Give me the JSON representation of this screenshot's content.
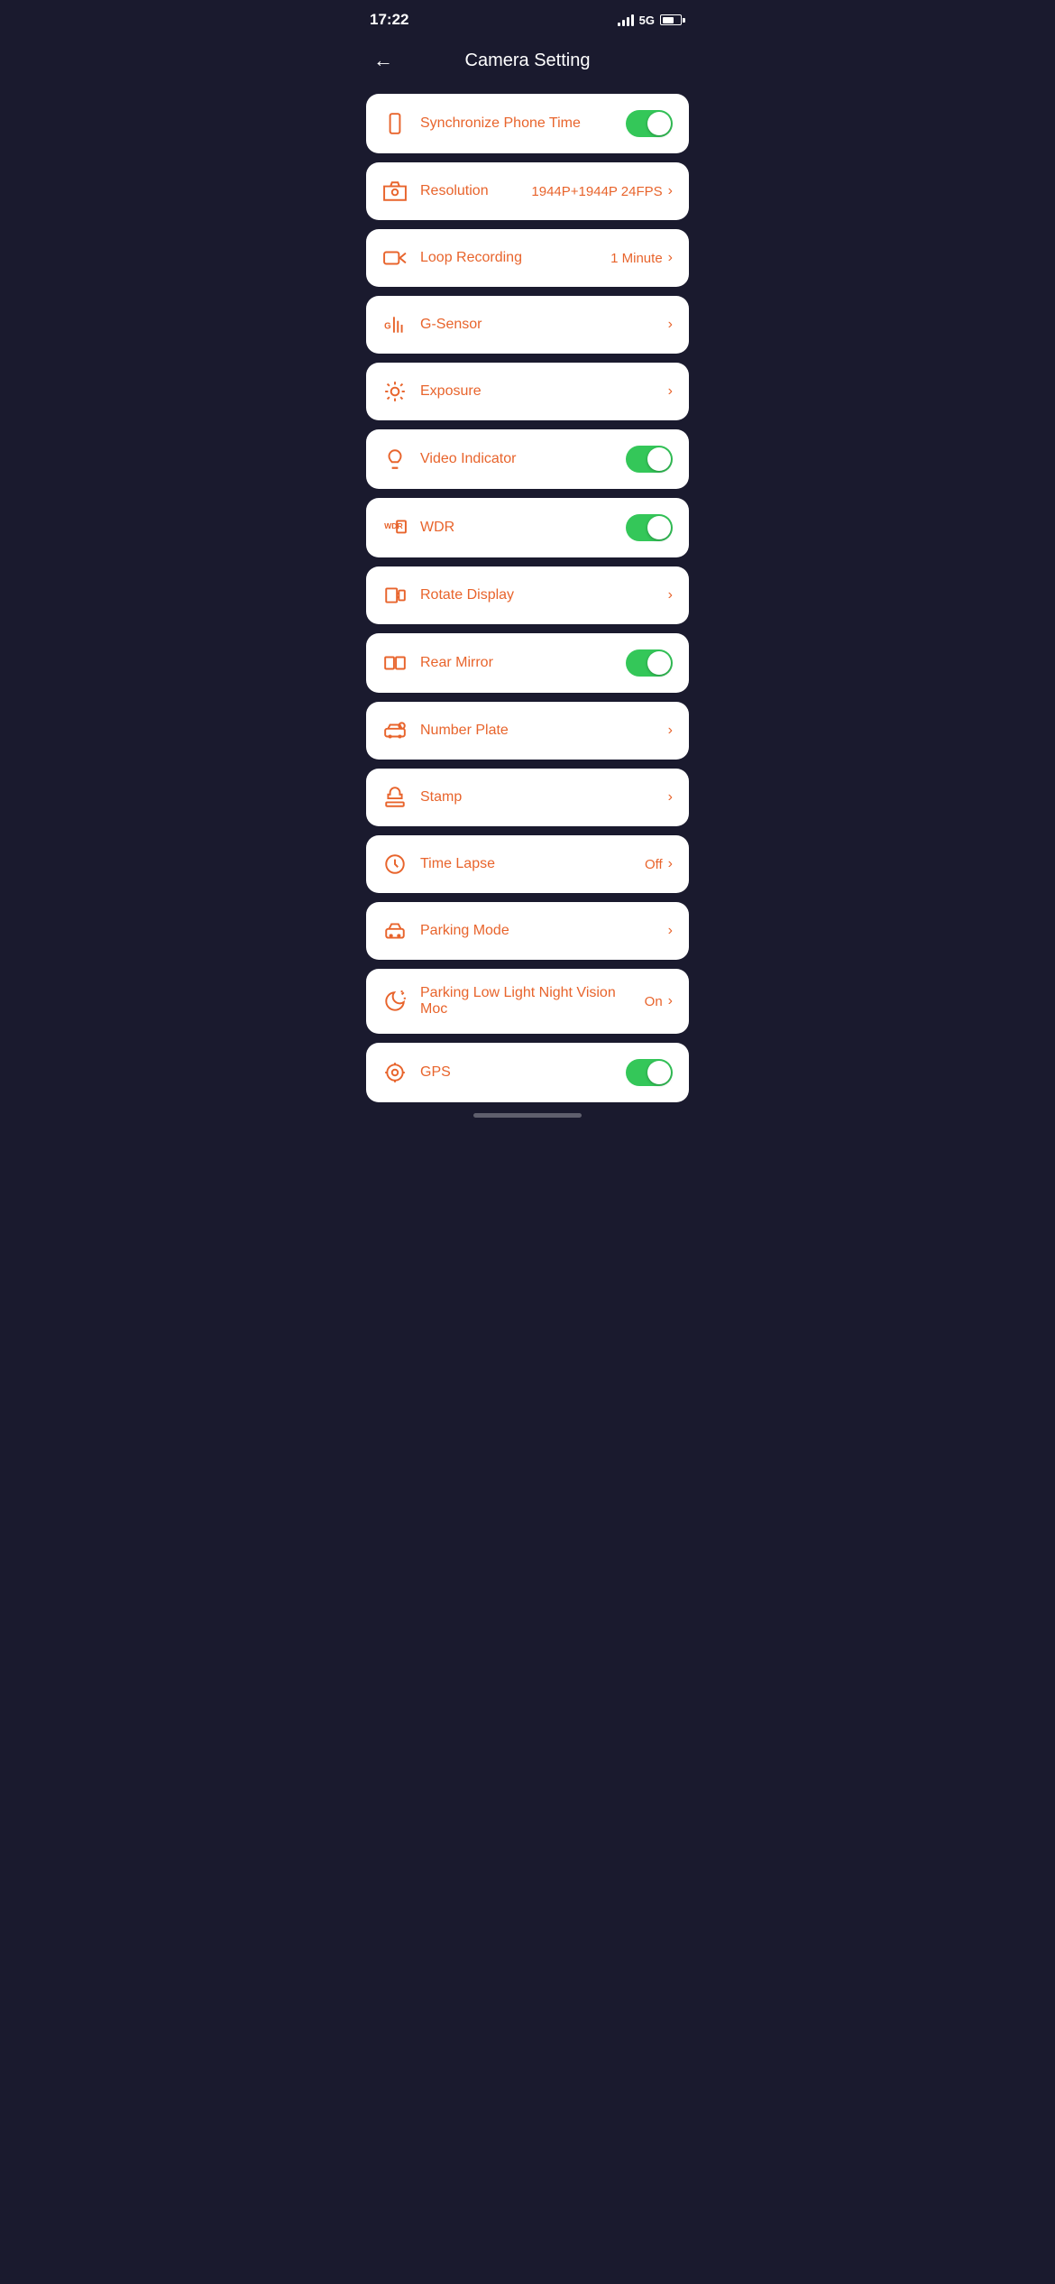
{
  "statusBar": {
    "time": "17:22",
    "network": "5G"
  },
  "header": {
    "backLabel": "←",
    "title": "Camera Setting"
  },
  "settings": [
    {
      "id": "sync-phone-time",
      "icon": "phone",
      "label": "Synchronize Phone Time",
      "type": "toggle",
      "toggleOn": true,
      "value": "",
      "hasChevron": false
    },
    {
      "id": "resolution",
      "icon": "camera",
      "label": "Resolution",
      "type": "value-chevron",
      "toggleOn": false,
      "value": "1944P+1944P 24FPS",
      "hasChevron": true
    },
    {
      "id": "loop-recording",
      "icon": "video",
      "label": "Loop Recording",
      "type": "value-chevron",
      "toggleOn": false,
      "value": "1 Minute",
      "hasChevron": true
    },
    {
      "id": "g-sensor",
      "icon": "gsensor",
      "label": "G-Sensor",
      "type": "chevron",
      "toggleOn": false,
      "value": "",
      "hasChevron": true
    },
    {
      "id": "exposure",
      "icon": "sun",
      "label": "Exposure",
      "type": "chevron",
      "toggleOn": false,
      "value": "",
      "hasChevron": true
    },
    {
      "id": "video-indicator",
      "icon": "bulb",
      "label": "Video Indicator",
      "type": "toggle",
      "toggleOn": true,
      "value": "",
      "hasChevron": false
    },
    {
      "id": "wdr",
      "icon": "wdr",
      "label": "WDR",
      "type": "toggle",
      "toggleOn": true,
      "value": "",
      "hasChevron": false
    },
    {
      "id": "rotate-display",
      "icon": "rotate",
      "label": "Rotate Display",
      "type": "chevron",
      "toggleOn": false,
      "value": "",
      "hasChevron": true
    },
    {
      "id": "rear-mirror",
      "icon": "mirror",
      "label": "Rear Mirror",
      "type": "toggle",
      "toggleOn": true,
      "value": "",
      "hasChevron": false
    },
    {
      "id": "number-plate",
      "icon": "car-settings",
      "label": "Number Plate",
      "type": "chevron",
      "toggleOn": false,
      "value": "",
      "hasChevron": true
    },
    {
      "id": "stamp",
      "icon": "stamp",
      "label": "Stamp",
      "type": "chevron",
      "toggleOn": false,
      "value": "",
      "hasChevron": true
    },
    {
      "id": "time-lapse",
      "icon": "timelapse",
      "label": "Time Lapse",
      "type": "value-chevron",
      "toggleOn": false,
      "value": "Off",
      "hasChevron": true
    },
    {
      "id": "parking-mode",
      "icon": "parking",
      "label": "Parking Mode",
      "type": "chevron",
      "toggleOn": false,
      "value": "",
      "hasChevron": true
    },
    {
      "id": "parking-night-vision",
      "icon": "moon",
      "label": "Parking Low Light Night Vision Moc",
      "type": "value-chevron",
      "toggleOn": false,
      "value": "On",
      "hasChevron": true
    },
    {
      "id": "gps",
      "icon": "gps",
      "label": "GPS",
      "type": "toggle",
      "toggleOn": true,
      "value": "",
      "hasChevron": false
    }
  ]
}
